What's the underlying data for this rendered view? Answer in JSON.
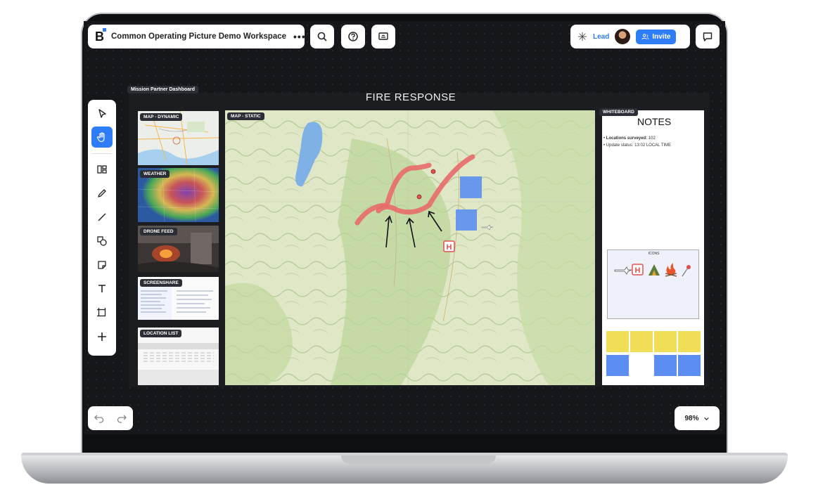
{
  "workspace": {
    "title": "Common Operating Picture Demo Workspace",
    "more_label": "•••"
  },
  "header": {
    "role_label": "Lead",
    "invite_label": "Invite"
  },
  "canvas": {
    "zoom_label": "98%"
  },
  "frame": {
    "label": "Mission Partner Dashboard",
    "title": "FIRE RESPONSE"
  },
  "tiles": {
    "map_dynamic": "MAP - DYNAMIC",
    "weather": "WEATHER",
    "drone": "DRONE FEED",
    "screenshare": "SCREENSHARE",
    "locations": "LOCATION LIST",
    "map_static": "MAP - STATIC",
    "whiteboard": "WHITEBOARD"
  },
  "notes": {
    "title": "NOTES",
    "line1_label": "Locations surveyed:",
    "line1_value": "102",
    "line2_label": "Update status:",
    "line2_value": "13:02 LOCAL TIME",
    "icons_label": "ICONS"
  },
  "colors": {
    "accent": "#2e7cf6",
    "fire_line": "#e86a6a",
    "sticky_yellow": "#f2dd58",
    "sticky_blue": "#5b8ef0"
  },
  "toolbar_icons": [
    "select-arrow-icon",
    "hand-icon",
    "layout-icon",
    "pencil-icon",
    "line-icon",
    "shapes-icon",
    "sticky-note-icon",
    "text-icon",
    "frame-icon",
    "plus-icon"
  ]
}
